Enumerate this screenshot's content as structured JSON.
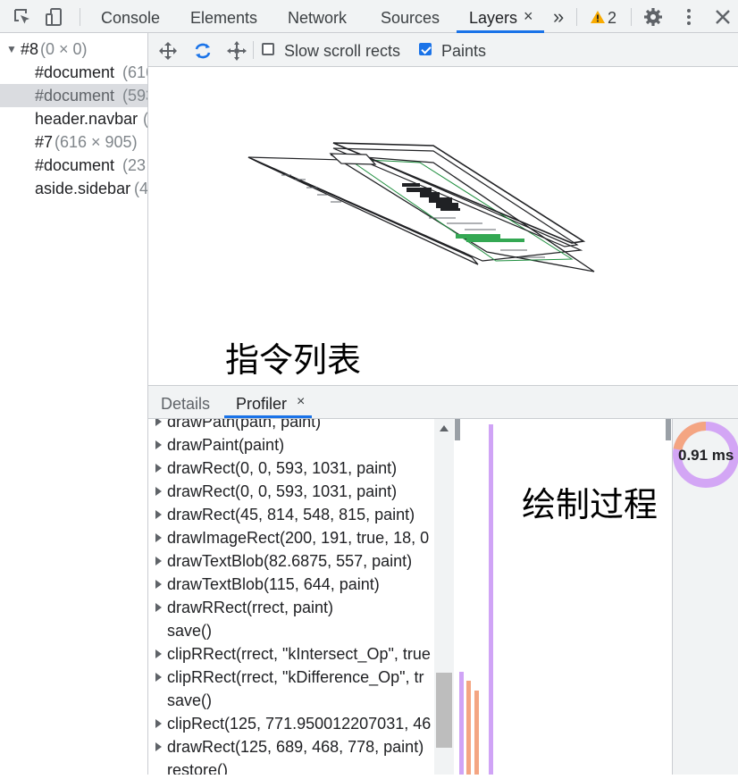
{
  "tabs": [
    {
      "label": "Console"
    },
    {
      "label": "Elements"
    },
    {
      "label": "Network"
    },
    {
      "label": "Sources"
    },
    {
      "label": "Layers",
      "close": "×"
    }
  ],
  "more_tabs": "»",
  "warning_count": "2",
  "layer_tree": [
    {
      "prefix": "#8",
      "dim": "(0 × 0)",
      "expand": "▼"
    },
    {
      "prefix": "#document",
      "dim": "(616"
    },
    {
      "prefix": "#document",
      "dim": "(593"
    },
    {
      "prefix": "header.navbar",
      "dim": "("
    },
    {
      "prefix": "#7",
      "dim": "(616 × 905)"
    },
    {
      "prefix": "#document",
      "dim": "(23"
    },
    {
      "prefix": "aside.sidebar",
      "dim": "(4"
    }
  ],
  "toolbar": {
    "slow_scroll_label": "Slow scroll rects",
    "slow_scroll_checked": false,
    "paints_label": "Paints",
    "paints_checked": true
  },
  "annotation_list": "指令列表",
  "annotation_draw": "绘制过程",
  "detail_tabs": {
    "details": "Details",
    "profiler": "Profiler",
    "close": "×"
  },
  "commands": [
    {
      "text": "drawPath(path, paint)",
      "expandable": true
    },
    {
      "text": "drawPaint(paint)",
      "expandable": true
    },
    {
      "text": "drawRect(0, 0, 593, 1031, paint)",
      "expandable": true
    },
    {
      "text": "drawRect(0, 0, 593, 1031, paint)",
      "expandable": true
    },
    {
      "text": "drawRect(45, 814, 548, 815, paint)",
      "expandable": true
    },
    {
      "text": "drawImageRect(200, 191, true, 18, 0",
      "expandable": true
    },
    {
      "text": "drawTextBlob(82.6875, 557, paint)",
      "expandable": true
    },
    {
      "text": "drawTextBlob(115, 644, paint)",
      "expandable": true
    },
    {
      "text": "drawRRect(rrect, paint)",
      "expandable": true
    },
    {
      "text": "save()",
      "expandable": false
    },
    {
      "text": "clipRRect(rrect, \"kIntersect_Op\", true",
      "expandable": true
    },
    {
      "text": "clipRRect(rrect, \"kDifference_Op\", tr",
      "expandable": true
    },
    {
      "text": "save()",
      "expandable": false
    },
    {
      "text": "clipRect(125, 771.950012207031, 46",
      "expandable": true
    },
    {
      "text": "drawRect(125, 689, 468, 778, paint)",
      "expandable": true
    },
    {
      "text": "restore()",
      "expandable": false
    }
  ],
  "pie": {
    "label": "0.91 ms",
    "colors": {
      "paint": "#d3a6f5",
      "other": "#f4a582"
    }
  },
  "colors": {
    "accent": "#1a73e8",
    "warning": "#f9ab00",
    "timeline_purple": "#d0a4f6",
    "timeline_orange": "#f4a582"
  }
}
